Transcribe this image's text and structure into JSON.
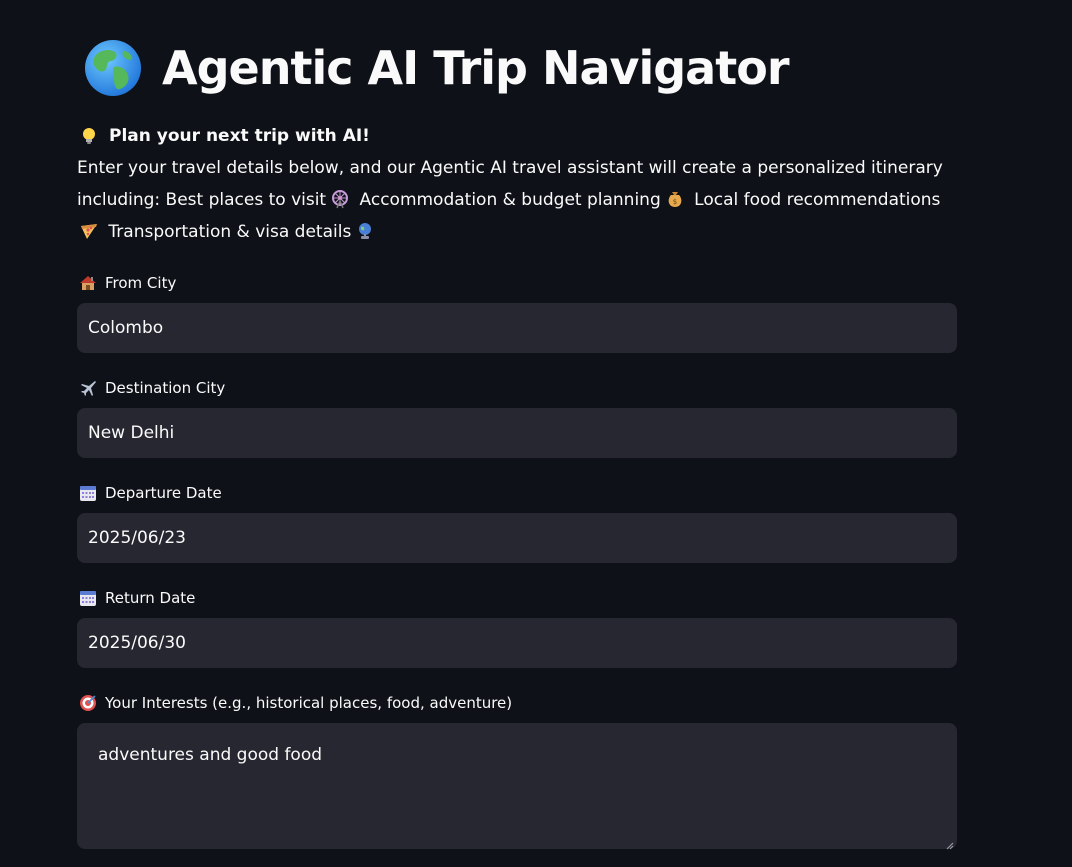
{
  "header": {
    "title": "Agentic AI Trip Navigator",
    "title_icon": "globe-icon"
  },
  "intro": {
    "heading": "Plan your next trip with AI!",
    "heading_icon": "lightbulb-icon",
    "line1": "Enter your travel details below, and our Agentic AI travel assistant will create a personalized itinerary",
    "line2_a": "including: Best places to visit",
    "line2_b": "Accommodation & budget planning",
    "line2_c": "Local food recommendations",
    "line3_a": "Transportation & visa details"
  },
  "form": {
    "from_city": {
      "label": "From City",
      "icon": "house-icon",
      "value": "Colombo"
    },
    "destination_city": {
      "label": "Destination City",
      "icon": "airplane-icon",
      "value": "New Delhi"
    },
    "departure_date": {
      "label": "Departure Date",
      "icon": "calendar-icon",
      "value": "2025/06/23"
    },
    "return_date": {
      "label": "Return Date",
      "icon": "calendar-icon",
      "value": "2025/06/30"
    },
    "interests": {
      "label": "Your Interests (e.g., historical places, food, adventure)",
      "icon": "target-icon",
      "value": "adventures and good food"
    }
  },
  "colors": {
    "background": "#0e1117",
    "input_background": "#262730",
    "text": "#fafafa"
  }
}
